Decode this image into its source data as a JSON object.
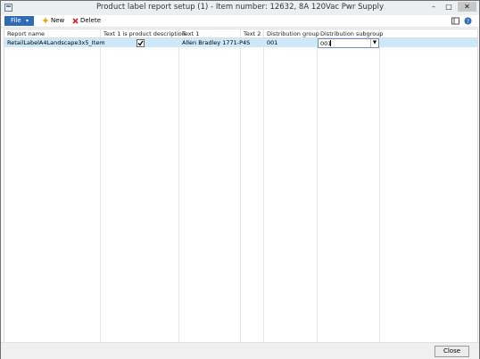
{
  "window": {
    "title": "Product label report setup (1) - Item number: 12632, 8A 120Vac Pwr Supply",
    "controls": {
      "minimize": "–",
      "maximize": "□",
      "close": "✕"
    }
  },
  "toolbar": {
    "file_label": "File",
    "new_label": "New",
    "delete_label": "Delete"
  },
  "grid": {
    "columns": [
      "Report name",
      "Text 1 is product description",
      "Text 1",
      "Text 2",
      "Distribution group",
      "Distribution subgroup"
    ],
    "rows": [
      {
        "report_name": "RetailLabelA4Landscape3x5_Item",
        "text1_is_product_description": true,
        "text1": "Allen Bradley 1771-P4S",
        "text2": "",
        "distribution_group": "001",
        "distribution_subgroup": "001"
      }
    ]
  },
  "footer": {
    "close_label": "Close"
  },
  "colors": {
    "accent": "#2e6db5",
    "selected_row": "#cde8f8"
  }
}
